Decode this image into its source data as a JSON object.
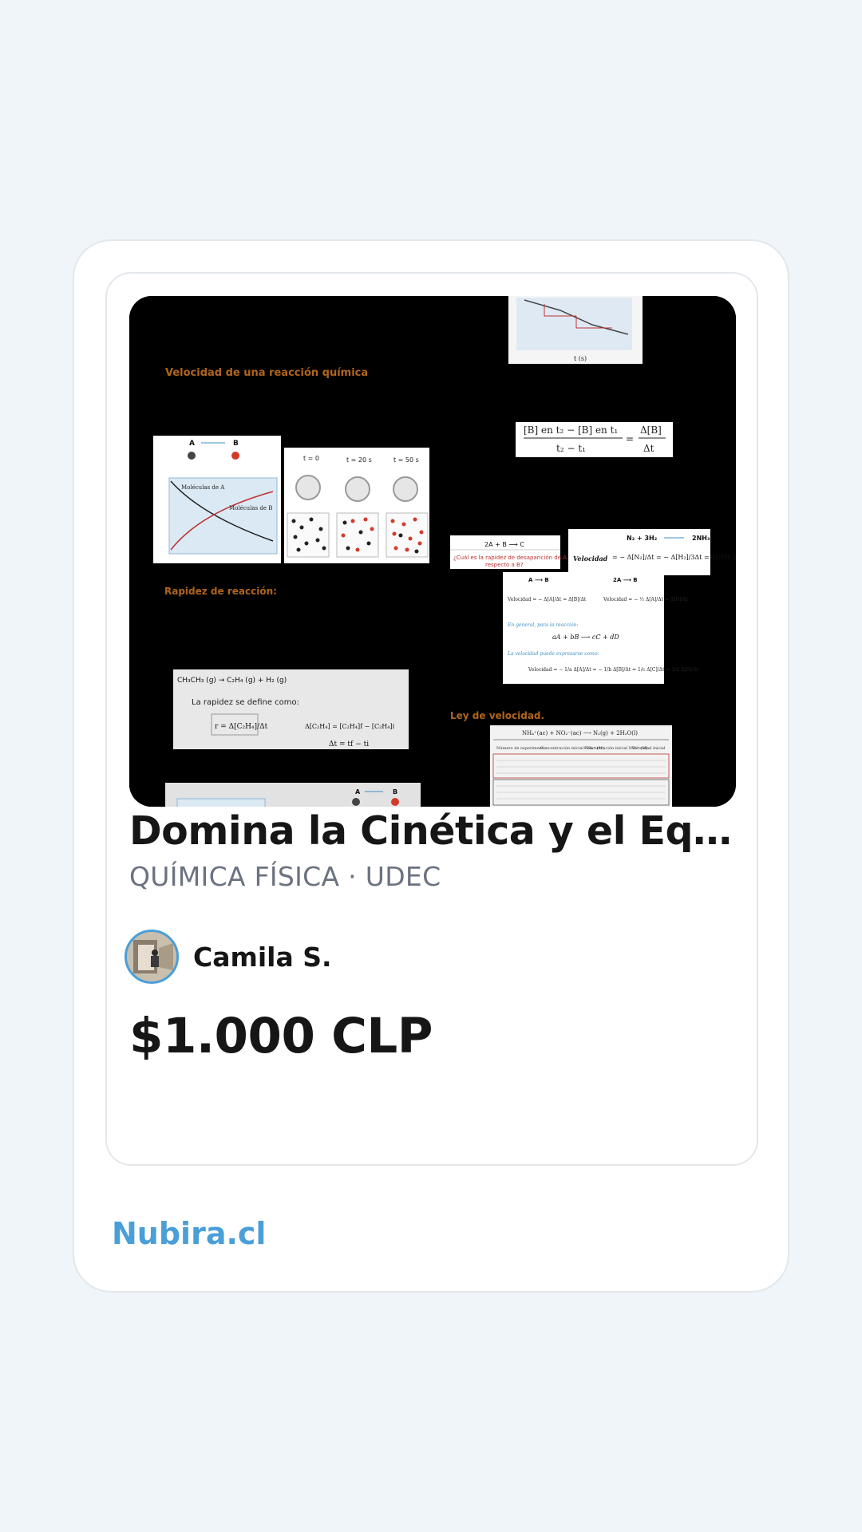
{
  "card": {
    "title": "Domina la Cinética y el Equilibrio Químico",
    "subtitle": "QUÍMICA FÍSICA · UDEC",
    "author": {
      "name": "Camila S.",
      "avatar_icon": "avatar-photo"
    },
    "price": "$1.000 CLP"
  },
  "thumbnail": {
    "heading_1": "Velocidad de una reacción química",
    "heading_2": "Rapidez de reacción:",
    "heading_3": "Ley de velocidad.",
    "accent_color": "#b0651c",
    "slide_labels": {
      "reaction_ab": "A ⟶ B",
      "mol_a": "Moléculas de A",
      "mol_b": "Moléculas de B",
      "t0": "t = 0",
      "t20": "t = 20 s",
      "t50": "t = 50 s",
      "question_reaction": "2A + B ⟶ C",
      "question": "¿Cuál es la rapidez de desaparición de A respecto a B?",
      "n2_reaction": "N₂ + 3H₂ ⟶ 2NH₃",
      "velocidad": "Velocidad",
      "ethane": "CH₃CH₃ (g) → C₂H₄ (g) + H₂ (g)",
      "rate_def": "La rapidez se define como:",
      "rate_formula": "r = Δ[C₂H₄] / Δt",
      "delta_t": "Δt = t_f − t_i",
      "general": "En general, para la reacción:",
      "general_eq": "aA + bB ⟶ cC + dD",
      "table_reaction": "NH₄⁺(ac) + NO₂⁻(ac) ⟶ N₂(g) + 2H₂O(l)",
      "b_rate": "[B] en t₂ − [B] en t₁ / t₂ − t₁ = Δ[B] / Δt"
    }
  },
  "footer": {
    "brand": "Nubira.cl"
  },
  "colors": {
    "background": "#f0f5f9",
    "brand_blue": "#4a9fd8",
    "text_dark": "#161616",
    "text_muted": "#6b7280"
  }
}
